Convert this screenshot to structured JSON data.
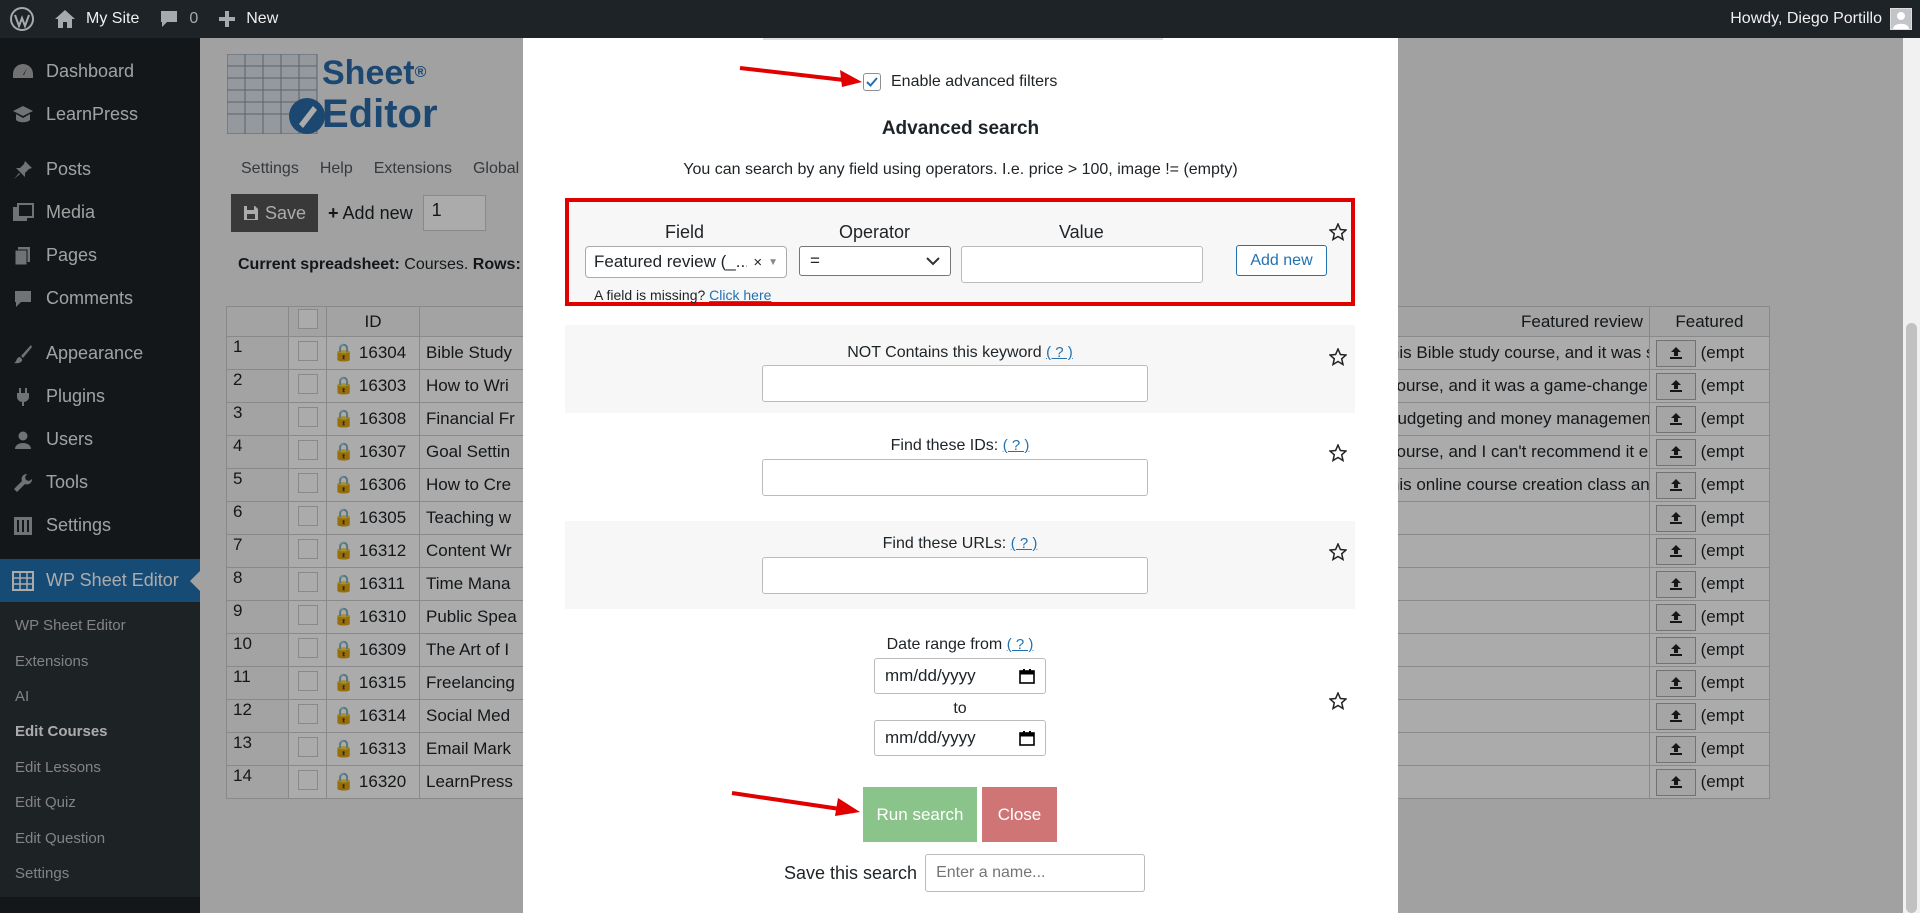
{
  "adminbar": {
    "site_name": "My Site",
    "comments_count": "0",
    "new_label": "New",
    "greeting": "Howdy, Diego Portillo"
  },
  "sidebar": {
    "items": [
      {
        "label": "Dashboard",
        "icon": "dashboard-icon"
      },
      {
        "label": "LearnPress",
        "icon": "learnpress-icon"
      },
      {
        "label": "Posts",
        "icon": "pin-icon"
      },
      {
        "label": "Media",
        "icon": "media-icon"
      },
      {
        "label": "Pages",
        "icon": "pages-icon"
      },
      {
        "label": "Comments",
        "icon": "comments-icon"
      },
      {
        "label": "Appearance",
        "icon": "brush-icon"
      },
      {
        "label": "Plugins",
        "icon": "plugin-icon"
      },
      {
        "label": "Users",
        "icon": "users-icon"
      },
      {
        "label": "Tools",
        "icon": "wrench-icon"
      },
      {
        "label": "Settings",
        "icon": "settings-icon"
      },
      {
        "label": "WP Sheet Editor",
        "icon": "spreadsheet-icon"
      }
    ],
    "submenu": [
      "WP Sheet Editor",
      "Extensions",
      "AI",
      "Edit Courses",
      "Edit Lessons",
      "Edit Quiz",
      "Edit Question",
      "Settings"
    ]
  },
  "page": {
    "logo_line1": "Sheet",
    "logo_line2": "Editor",
    "logo_mark": "®",
    "subnav": [
      "Settings",
      "Help",
      "Extensions",
      "Global s"
    ],
    "save_label": "Save",
    "add_new_label": "Add new",
    "add_new_count": "1",
    "current_sheet_label": "Current spreadsheet:",
    "current_sheet_value": "Courses.",
    "rows_label": "Rows:"
  },
  "grid": {
    "headers": {
      "id": "ID",
      "featured_review": "Featured review",
      "featured": "Featured"
    },
    "rows": [
      {
        "n": "1",
        "id": "16304",
        "title": "Bible Study",
        "review": "o this Bible study course, and it was such a game c...",
        "featured": "(empt"
      },
      {
        "n": "2",
        "id": "16303",
        "title": "How to Wri",
        "review": "is course, and it was a game-changer! The step-b...",
        "featured": "(empt"
      },
      {
        "n": "3",
        "id": "16308",
        "title": "Financial Fr",
        "review": "is budgeting and money management course, an...",
        "featured": "(empt"
      },
      {
        "n": "4",
        "id": "16307",
        "title": "Goal Settin",
        "review": "is course, and I can't recommend it enough! It rea...",
        "featured": "(empt"
      },
      {
        "n": "5",
        "id": "16306",
        "title": "How to Cre",
        "review": "o this online course creation class and I couldn't b...",
        "featured": "(empt"
      },
      {
        "n": "6",
        "id": "16305",
        "title": "Teaching w",
        "review": "",
        "featured": "(empt"
      },
      {
        "n": "7",
        "id": "16312",
        "title": "Content Wr",
        "review": "",
        "featured": "(empt"
      },
      {
        "n": "8",
        "id": "16311",
        "title": "Time Mana",
        "review": "",
        "featured": "(empt"
      },
      {
        "n": "9",
        "id": "16310",
        "title": "Public Spea",
        "review": "",
        "featured": "(empt"
      },
      {
        "n": "10",
        "id": "16309",
        "title": "The Art of I",
        "review": "",
        "featured": "(empt"
      },
      {
        "n": "11",
        "id": "16315",
        "title": "Freelancing",
        "review": "",
        "featured": "(empt"
      },
      {
        "n": "12",
        "id": "16314",
        "title": "Social Med",
        "review": "",
        "featured": "(empt"
      },
      {
        "n": "13",
        "id": "16313",
        "title": "Email Mark",
        "review": "",
        "featured": "(empt"
      },
      {
        "n": "14",
        "id": "16320",
        "title": "LearnPress",
        "review": "",
        "featured": "(empt"
      }
    ]
  },
  "modal": {
    "enable_advanced_label": "Enable advanced filters",
    "enable_advanced_checked": true,
    "advanced_title": "Advanced search",
    "advanced_desc": "You can search by any field using operators. I.e. price > 100, image != (empty)",
    "field_label": "Field",
    "operator_label": "Operator",
    "value_label": "Value",
    "field_value": "Featured review (_...",
    "operator_value": "=",
    "add_new_label": "Add new",
    "missing_text": "A field is missing?",
    "missing_link": "Click here",
    "not_contains_label": "NOT Contains this keyword",
    "help_text": "( ? )",
    "find_ids_label": "Find these IDs:",
    "find_urls_label": "Find these URLs:",
    "date_range_label": "Date range from",
    "date_placeholder": "mm/dd/yyyy",
    "to_label": "to",
    "run_search_label": "Run search",
    "close_label": "Close",
    "save_search_label": "Save this search",
    "save_search_placeholder": "Enter a name..."
  },
  "colors": {
    "highlight_border": "#e00000",
    "run_button": "#8bc48b",
    "close_button": "#d07575",
    "admin_blue": "#2271b1",
    "arrow": "#e00000"
  }
}
